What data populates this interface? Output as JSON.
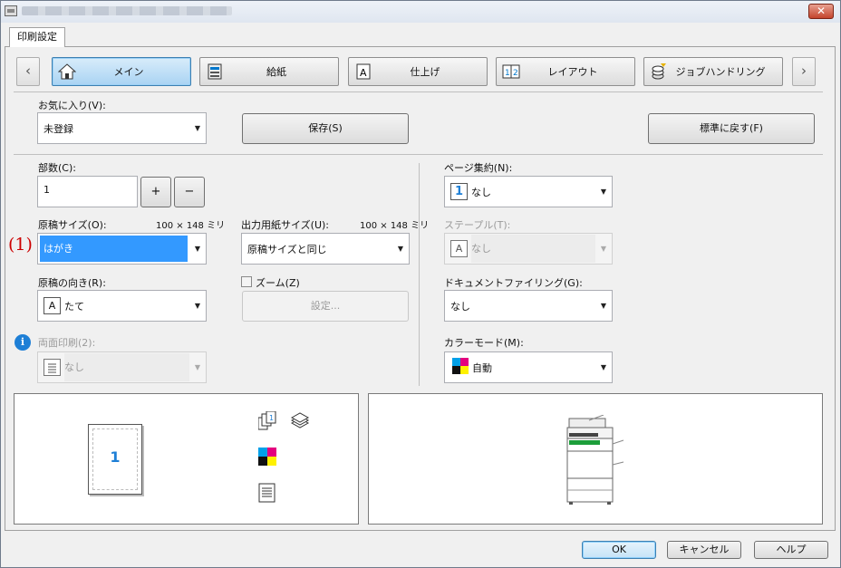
{
  "window": {
    "close_glyph": "✕"
  },
  "tab": {
    "label": "印刷設定"
  },
  "nav": {
    "prev_glyph": "‹",
    "next_glyph": "›",
    "items": [
      {
        "label": "メイン",
        "icon": "home-icon"
      },
      {
        "label": "給紙",
        "icon": "paper-tray-icon"
      },
      {
        "label": "仕上げ",
        "icon": "finishing-icon"
      },
      {
        "label": "レイアウト",
        "icon": "layout-icon"
      },
      {
        "label": "ジョブハンドリング",
        "icon": "job-handling-icon"
      }
    ]
  },
  "favorites": {
    "label": "お気に入り(V):",
    "value": "未登録",
    "save_label": "保存(S)",
    "reset_label": "標準に戻す(F)"
  },
  "copies": {
    "label": "部数(C):",
    "value": "1",
    "plus": "+",
    "minus": "−"
  },
  "original_size": {
    "label": "原稿サイズ(O):",
    "dims": "100 × 148 ミリ",
    "value": "はがき",
    "callout": "(1)"
  },
  "output_size": {
    "label": "出力用紙サイズ(U):",
    "dims": "100 × 148 ミリ",
    "value": "原稿サイズと同じ"
  },
  "orientation": {
    "label": "原稿の向き(R):",
    "value": "たて",
    "icon_text": "A"
  },
  "zoom": {
    "label": "ズーム(Z)",
    "settings_label": "設定..."
  },
  "duplex": {
    "label": "両面印刷(2):",
    "value": "なし"
  },
  "pages_per_sheet": {
    "label": "ページ集約(N):",
    "value": "なし",
    "icon_text": "1"
  },
  "staple": {
    "label": "ステープル(T):",
    "value": "なし",
    "icon_text": "A"
  },
  "document_filing": {
    "label": "ドキュメントファイリング(G):",
    "value": "なし"
  },
  "color_mode": {
    "label": "カラーモード(M):",
    "value": "自動"
  },
  "preview": {
    "page_number": "1"
  },
  "footer": {
    "ok_label": "OK",
    "cancel_label": "キャンセル",
    "help_label": "ヘルプ"
  },
  "colors": {
    "accent": "#3399ff",
    "callout": "#cc0000"
  }
}
